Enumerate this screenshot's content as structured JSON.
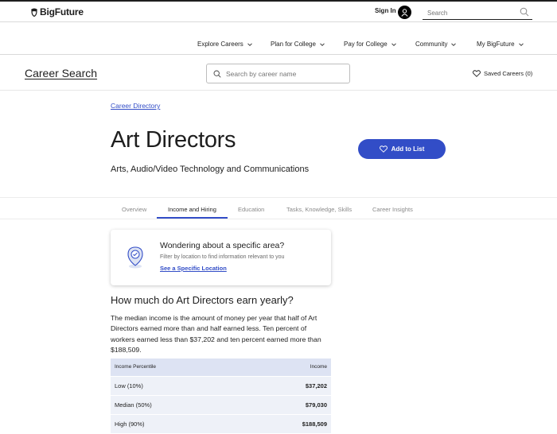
{
  "header": {
    "logo_text": "BigFuture",
    "signin_label": "Sign In",
    "search_placeholder": "Search"
  },
  "nav": {
    "items": [
      {
        "label": "Explore Careers"
      },
      {
        "label": "Plan for College"
      },
      {
        "label": "Pay for College"
      },
      {
        "label": "Community"
      },
      {
        "label": "My BigFuture"
      }
    ]
  },
  "subheader": {
    "title": "Career Search",
    "search_placeholder": "Search by career name",
    "saved_label": "Saved Careers (0)"
  },
  "breadcrumb": {
    "label": "Career Directory"
  },
  "career": {
    "title": "Art Directors",
    "cluster": "Arts, Audio/Video Technology and Communications",
    "add_button_label": "Add to List"
  },
  "tabs": [
    {
      "label": "Overview",
      "active": false
    },
    {
      "label": "Income and Hiring",
      "active": true
    },
    {
      "label": "Education",
      "active": false
    },
    {
      "label": "Tasks, Knowledge, Skills",
      "active": false
    },
    {
      "label": "Career Insights",
      "active": false
    }
  ],
  "location_card": {
    "title": "Wondering about a specific area?",
    "description": "Filter by location to find information relevant to you",
    "link": "See a Specific Location"
  },
  "income": {
    "heading": "How much do Art Directors earn yearly?",
    "paragraph": "The median income is the amount of money per year that half of Art Directors earned more than and half earned less. Ten percent of workers earned less than $37,202 and ten percent earned more than $188,509.",
    "table": {
      "headers": [
        "Income Percentile",
        "Income"
      ],
      "rows": [
        {
          "percentile": "Low (10%)",
          "income": "$37,202"
        },
        {
          "percentile": "Median (50%)",
          "income": "$79,030"
        },
        {
          "percentile": "High (90%)",
          "income": "$188,509"
        }
      ]
    }
  },
  "colors": {
    "accent": "#324dc7",
    "table_header": "#dde3f3",
    "table_row": "#eef1f8"
  }
}
